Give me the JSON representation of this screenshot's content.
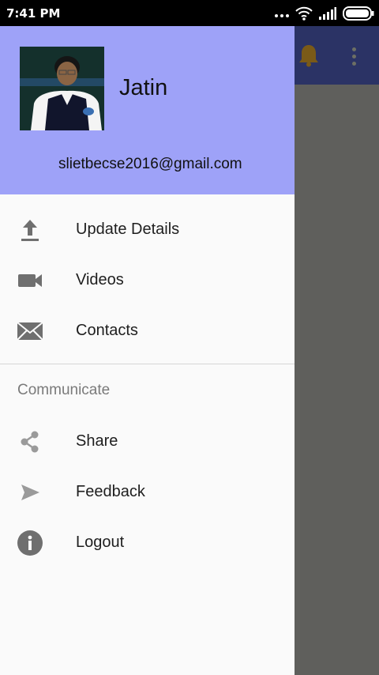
{
  "status_bar": {
    "time": "7:41 PM",
    "icons": [
      "more-dots-icon",
      "wifi-icon",
      "signal-icon",
      "battery-icon"
    ]
  },
  "background_app": {
    "toolbar_color": "#2b3365",
    "icons": [
      "notification-bell-icon",
      "overflow-menu-icon"
    ]
  },
  "drawer": {
    "header_color": "#9ea2f8",
    "user": {
      "name": "Jatin",
      "email": "slietbecse2016@gmail.com"
    },
    "items": [
      {
        "label": "Update Details",
        "icon": "upload-icon"
      },
      {
        "label": "Videos",
        "icon": "videocam-icon"
      },
      {
        "label": "Contacts",
        "icon": "envelope-icon"
      }
    ],
    "section": {
      "title": "Communicate",
      "items": [
        {
          "label": "Share",
          "icon": "share-icon"
        },
        {
          "label": "Feedback",
          "icon": "send-icon"
        },
        {
          "label": "Logout",
          "icon": "info-icon"
        }
      ]
    }
  }
}
